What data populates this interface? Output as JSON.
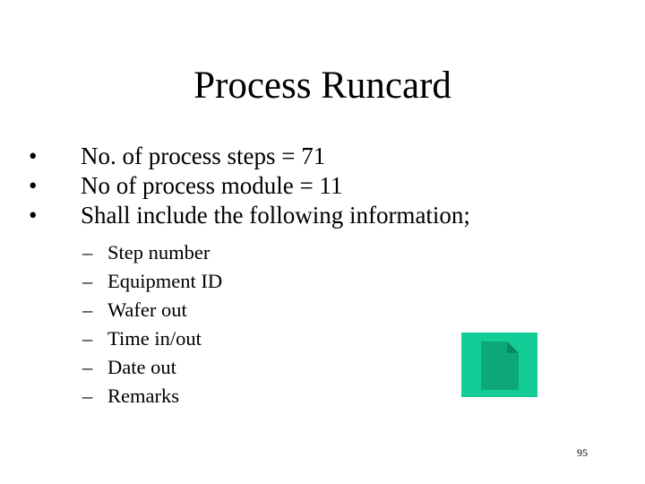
{
  "slide": {
    "title": "Process Runcard",
    "bullets": [
      {
        "marker": "•",
        "text": "No. of process steps = 71"
      },
      {
        "marker": "•",
        "text": "No of process module = 11"
      },
      {
        "marker": "•",
        "text": "Shall include the following information;"
      }
    ],
    "sub_bullets": [
      {
        "marker": "–",
        "text": "Step number"
      },
      {
        "marker": "–",
        "text": "Equipment ID"
      },
      {
        "marker": "–",
        "text": "Wafer out"
      },
      {
        "marker": "–",
        "text": "Time in/out"
      },
      {
        "marker": "–",
        "text": "Date out"
      },
      {
        "marker": "–",
        "text": "Remarks"
      }
    ],
    "embedded_object": {
      "icon": "document-icon",
      "background_color": "#14cc96",
      "page_color": "#0ea878",
      "fold_color": "#0a8a62"
    },
    "page_number": "95"
  }
}
